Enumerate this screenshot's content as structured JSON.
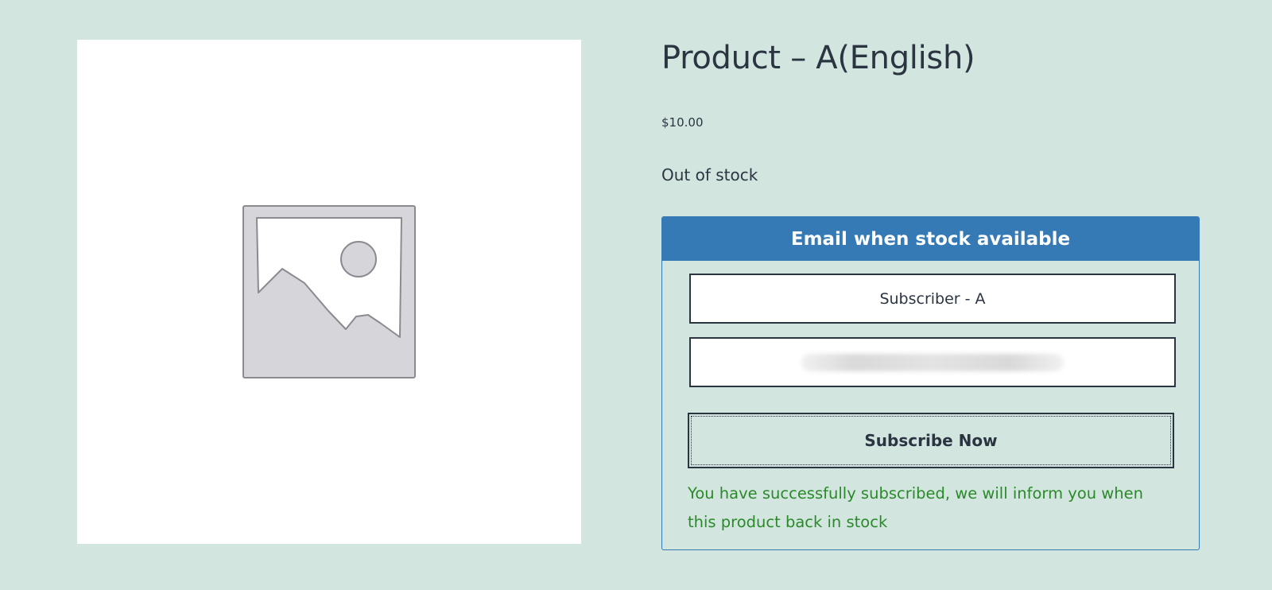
{
  "product": {
    "title": "Product – A(English)",
    "price": "$10.00",
    "stock_status": "Out of stock",
    "image_icon": "placeholder-image-icon"
  },
  "notify": {
    "header": "Email when stock available",
    "name_value": "Subscriber - A",
    "email_value": "",
    "subscribe_label": "Subscribe Now",
    "success_message": "You have successfully subscribed, we will inform you when this product back in stock"
  },
  "colors": {
    "background": "#d2e5df",
    "header_blue": "#3579b5",
    "text_dark": "#2b3542",
    "success_green": "#2a8a2a"
  }
}
